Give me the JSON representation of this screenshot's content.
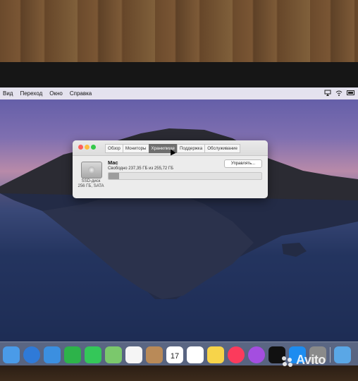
{
  "menubar": {
    "items": [
      "Вид",
      "Переход",
      "Окно",
      "Справка"
    ]
  },
  "window": {
    "tabs": [
      "Обзор",
      "Мониторы",
      "Хранилище",
      "Поддержка",
      "Обслуживание"
    ],
    "active_tab": "Хранилище",
    "volume_name": "Mac",
    "free_text": "Свободно 237,35 ГБ из 255,72 ГБ",
    "manage_label": "Управлять...",
    "disk_type": "SSD-диск",
    "disk_spec": "256 ГБ, SATA",
    "used_fraction": 0.07
  },
  "dock": {
    "icons": [
      "finder-icon",
      "safari-icon",
      "mail-icon",
      "facetime-icon",
      "messages-icon",
      "maps-icon",
      "photos-icon",
      "contacts-icon",
      "calendar-icon",
      "reminders-icon",
      "notes-icon",
      "music-icon",
      "podcasts-icon",
      "tv-icon",
      "app-store-icon",
      "system-preferences-icon",
      "downloads-folder-icon"
    ],
    "calendar_day": "17"
  },
  "watermark": {
    "text": "Avito"
  }
}
